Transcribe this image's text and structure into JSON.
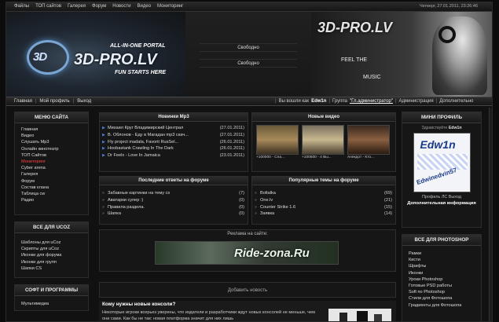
{
  "topbar": {
    "nav": [
      "Файлы",
      "ТОП сайтов",
      "Галерея",
      "Форум",
      "Новости",
      "Видео",
      "Мониторинг"
    ],
    "date": "Четверг, 27.01.2011, 23:26:46"
  },
  "header": {
    "logo_top": "ALL-IN-ONE PORTAL",
    "logo_mark": "3D",
    "logo_main": "3D-PRO.LV",
    "logo_sub": "FUN STARTS HERE",
    "free_1": "Свободно",
    "free_2": "Свободно",
    "right_logo": "3D-PRO.LV",
    "right_feel": "FEEL THE",
    "right_music": "MUSIC"
  },
  "subnav": {
    "links": [
      "Главная",
      "Мой профиль",
      "Выход"
    ],
    "logged_in_label": "Вы вошли как",
    "username": "Edw1n",
    "group_label": "Группа",
    "group": "\"Гл.администратор\"",
    "admin": "Администрация",
    "more": "Дополнительно"
  },
  "menu": {
    "title": "МЕНЮ САЙТА",
    "items": [
      "Главная",
      "Видео",
      "Слушать Mp3",
      "Онлайн кинотеатр",
      "ТОП Сайтов",
      "Мониторинг",
      "Cyber arena",
      "Галерея",
      "Форум",
      "Состав клана",
      "Таблица cw",
      "Радио"
    ]
  },
  "ucoz": {
    "title": "ВСЕ ДЛЯ UCOZ",
    "items": [
      "Шаблоны для uCoz",
      "Скрипты для uCoz",
      "Иконки для форума",
      "Иконки для групп",
      "Шапки CS"
    ]
  },
  "soft": {
    "title": "СОФТ И ПРОГРАММЫ",
    "items": [
      "Мультимедиа"
    ]
  },
  "mp3": {
    "title": "Новинки Mp3",
    "rows": [
      {
        "text": "Михаил Круг Владимирский Централ",
        "date": "(27.01.2011)"
      },
      {
        "text": "В. Облонов - Еду в Магадан mp3 скач...",
        "date": "(27.01.2011)"
      },
      {
        "text": "Fly project madala, Favorit RusSel...",
        "date": "(26.01.2011)"
      },
      {
        "text": "Hoobastank Crawling In The Dark",
        "date": "(26.01.2011)"
      },
      {
        "text": "Dr Feelx - Love In Jamaica",
        "date": "(23.01.2011)"
      }
    ]
  },
  "video": {
    "title": "Новые видео",
    "captions": [
      "+100000 - Сла...",
      "+100500 - 4 Вы...",
      "Анекдот - Кто..."
    ]
  },
  "forum_answers": {
    "title": "Последние ответы на форуме",
    "rows": [
      {
        "text": "Забавные картинки на тему cs",
        "count": "(7)"
      },
      {
        "text": "Аватарки супер :)",
        "count": "(0)"
      },
      {
        "text": "Правила раздела.",
        "count": "(0)"
      },
      {
        "text": "Шапка",
        "count": "(0)"
      }
    ]
  },
  "forum_popular": {
    "title": "Популярные темы на форуме",
    "rows": [
      {
        "text": "Boltalka",
        "count": "(69)"
      },
      {
        "text": "One.lv",
        "count": "(21)"
      },
      {
        "text": "Counter Strike 1.6",
        "count": "(15)"
      },
      {
        "text": "Заявка",
        "count": "(14)"
      }
    ]
  },
  "ad": {
    "title": "Реклама на сайте:",
    "banner_text": "Ride-zona.Ru"
  },
  "add_news": "Добавить новость",
  "news": {
    "title": "Кому нужны новые консоли?",
    "body": "Некоторые игроки всерьез уверены, что издатели и разработчики ждут новых консолей не меньше, чем они сами. Как бы не так: новая платформа значит для них лишь"
  },
  "profile": {
    "title": "МИНИ ПРОФИЛЬ",
    "hello": "Здравствуйте",
    "username": "Edw1n",
    "avatar_top": "Edw1n",
    "avatar_bottom": "Edwinedvin57",
    "links": [
      "Профиль",
      "ЛС",
      "Выход"
    ],
    "extra": "Дополнительная информация"
  },
  "photoshop": {
    "title": "ВСЕ ДЛЯ PHOTOSHOP",
    "items": [
      "Рамки",
      "Кисти",
      "Шрифты",
      "Иконки",
      "Уроки Photoshop",
      "Готовые PSD работы",
      "Soft по Photoshop",
      "Стили для Фотошопа",
      "Градиенты для Фотошопа"
    ]
  }
}
